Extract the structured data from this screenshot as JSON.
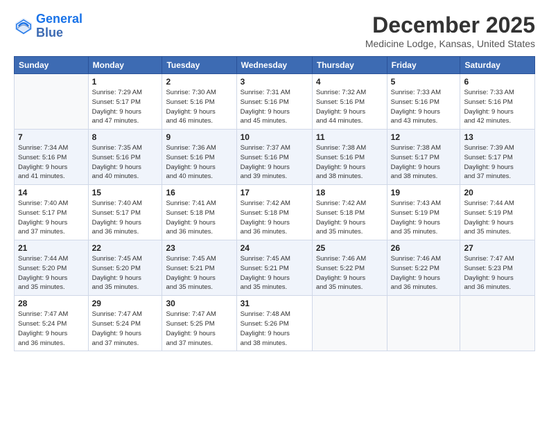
{
  "header": {
    "logo_line1": "General",
    "logo_line2": "Blue",
    "month": "December 2025",
    "location": "Medicine Lodge, Kansas, United States"
  },
  "days_of_week": [
    "Sunday",
    "Monday",
    "Tuesday",
    "Wednesday",
    "Thursday",
    "Friday",
    "Saturday"
  ],
  "weeks": [
    [
      {
        "num": "",
        "detail": ""
      },
      {
        "num": "1",
        "detail": "Sunrise: 7:29 AM\nSunset: 5:17 PM\nDaylight: 9 hours\nand 47 minutes."
      },
      {
        "num": "2",
        "detail": "Sunrise: 7:30 AM\nSunset: 5:16 PM\nDaylight: 9 hours\nand 46 minutes."
      },
      {
        "num": "3",
        "detail": "Sunrise: 7:31 AM\nSunset: 5:16 PM\nDaylight: 9 hours\nand 45 minutes."
      },
      {
        "num": "4",
        "detail": "Sunrise: 7:32 AM\nSunset: 5:16 PM\nDaylight: 9 hours\nand 44 minutes."
      },
      {
        "num": "5",
        "detail": "Sunrise: 7:33 AM\nSunset: 5:16 PM\nDaylight: 9 hours\nand 43 minutes."
      },
      {
        "num": "6",
        "detail": "Sunrise: 7:33 AM\nSunset: 5:16 PM\nDaylight: 9 hours\nand 42 minutes."
      }
    ],
    [
      {
        "num": "7",
        "detail": "Sunrise: 7:34 AM\nSunset: 5:16 PM\nDaylight: 9 hours\nand 41 minutes."
      },
      {
        "num": "8",
        "detail": "Sunrise: 7:35 AM\nSunset: 5:16 PM\nDaylight: 9 hours\nand 40 minutes."
      },
      {
        "num": "9",
        "detail": "Sunrise: 7:36 AM\nSunset: 5:16 PM\nDaylight: 9 hours\nand 40 minutes."
      },
      {
        "num": "10",
        "detail": "Sunrise: 7:37 AM\nSunset: 5:16 PM\nDaylight: 9 hours\nand 39 minutes."
      },
      {
        "num": "11",
        "detail": "Sunrise: 7:38 AM\nSunset: 5:16 PM\nDaylight: 9 hours\nand 38 minutes."
      },
      {
        "num": "12",
        "detail": "Sunrise: 7:38 AM\nSunset: 5:17 PM\nDaylight: 9 hours\nand 38 minutes."
      },
      {
        "num": "13",
        "detail": "Sunrise: 7:39 AM\nSunset: 5:17 PM\nDaylight: 9 hours\nand 37 minutes."
      }
    ],
    [
      {
        "num": "14",
        "detail": "Sunrise: 7:40 AM\nSunset: 5:17 PM\nDaylight: 9 hours\nand 37 minutes."
      },
      {
        "num": "15",
        "detail": "Sunrise: 7:40 AM\nSunset: 5:17 PM\nDaylight: 9 hours\nand 36 minutes."
      },
      {
        "num": "16",
        "detail": "Sunrise: 7:41 AM\nSunset: 5:18 PM\nDaylight: 9 hours\nand 36 minutes."
      },
      {
        "num": "17",
        "detail": "Sunrise: 7:42 AM\nSunset: 5:18 PM\nDaylight: 9 hours\nand 36 minutes."
      },
      {
        "num": "18",
        "detail": "Sunrise: 7:42 AM\nSunset: 5:18 PM\nDaylight: 9 hours\nand 35 minutes."
      },
      {
        "num": "19",
        "detail": "Sunrise: 7:43 AM\nSunset: 5:19 PM\nDaylight: 9 hours\nand 35 minutes."
      },
      {
        "num": "20",
        "detail": "Sunrise: 7:44 AM\nSunset: 5:19 PM\nDaylight: 9 hours\nand 35 minutes."
      }
    ],
    [
      {
        "num": "21",
        "detail": "Sunrise: 7:44 AM\nSunset: 5:20 PM\nDaylight: 9 hours\nand 35 minutes."
      },
      {
        "num": "22",
        "detail": "Sunrise: 7:45 AM\nSunset: 5:20 PM\nDaylight: 9 hours\nand 35 minutes."
      },
      {
        "num": "23",
        "detail": "Sunrise: 7:45 AM\nSunset: 5:21 PM\nDaylight: 9 hours\nand 35 minutes."
      },
      {
        "num": "24",
        "detail": "Sunrise: 7:45 AM\nSunset: 5:21 PM\nDaylight: 9 hours\nand 35 minutes."
      },
      {
        "num": "25",
        "detail": "Sunrise: 7:46 AM\nSunset: 5:22 PM\nDaylight: 9 hours\nand 35 minutes."
      },
      {
        "num": "26",
        "detail": "Sunrise: 7:46 AM\nSunset: 5:22 PM\nDaylight: 9 hours\nand 36 minutes."
      },
      {
        "num": "27",
        "detail": "Sunrise: 7:47 AM\nSunset: 5:23 PM\nDaylight: 9 hours\nand 36 minutes."
      }
    ],
    [
      {
        "num": "28",
        "detail": "Sunrise: 7:47 AM\nSunset: 5:24 PM\nDaylight: 9 hours\nand 36 minutes."
      },
      {
        "num": "29",
        "detail": "Sunrise: 7:47 AM\nSunset: 5:24 PM\nDaylight: 9 hours\nand 37 minutes."
      },
      {
        "num": "30",
        "detail": "Sunrise: 7:47 AM\nSunset: 5:25 PM\nDaylight: 9 hours\nand 37 minutes."
      },
      {
        "num": "31",
        "detail": "Sunrise: 7:48 AM\nSunset: 5:26 PM\nDaylight: 9 hours\nand 38 minutes."
      },
      {
        "num": "",
        "detail": ""
      },
      {
        "num": "",
        "detail": ""
      },
      {
        "num": "",
        "detail": ""
      }
    ]
  ]
}
